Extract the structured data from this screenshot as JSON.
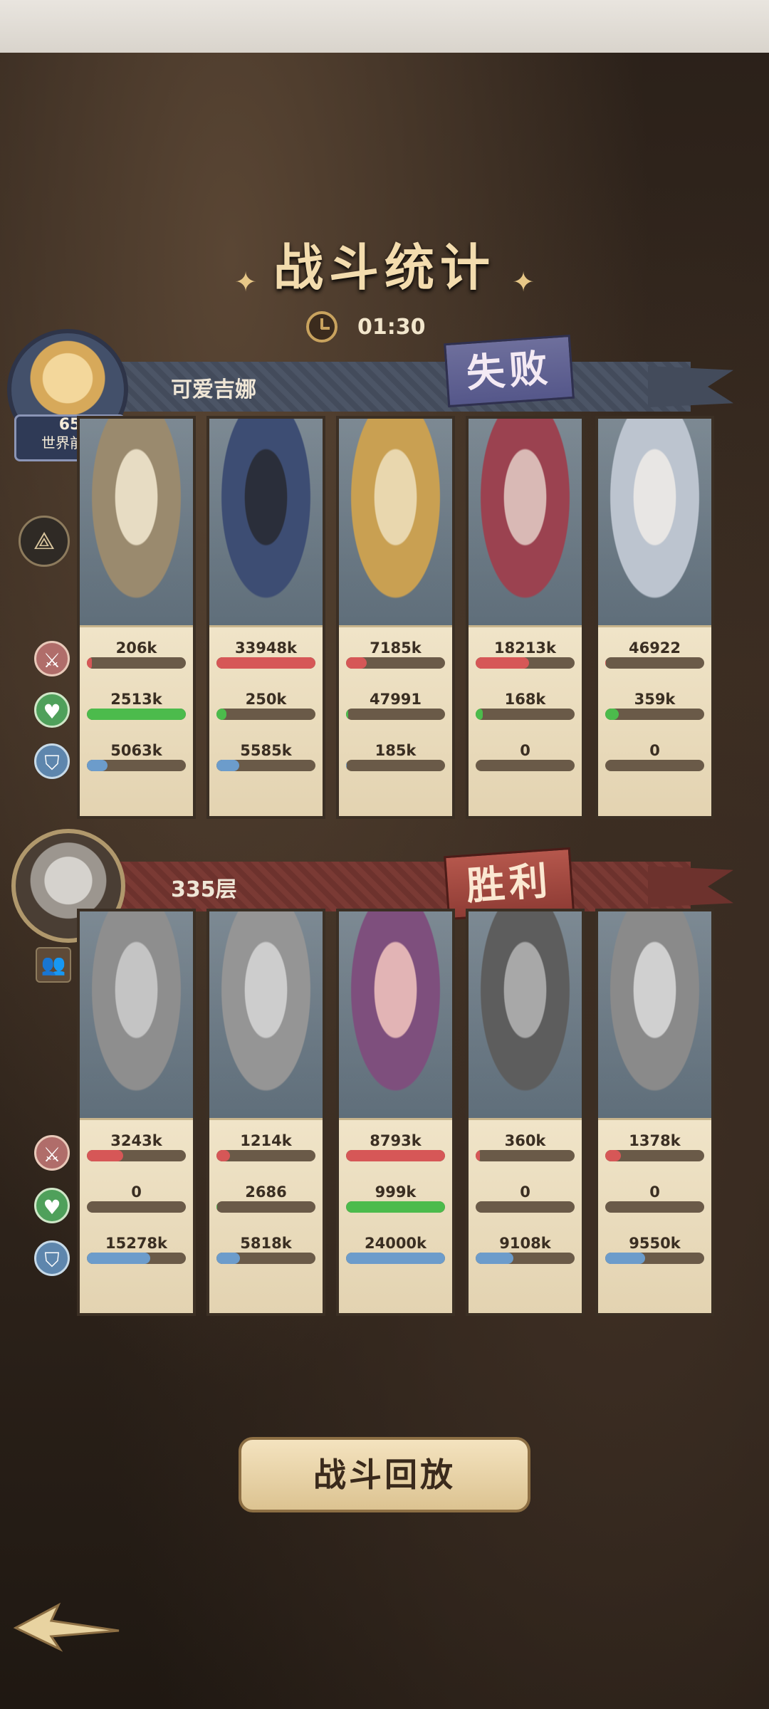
{
  "title": "战斗统计",
  "timer": "01:30",
  "team1": {
    "name": "可爱吉娜",
    "result": "失败",
    "level": "65",
    "rank_tag": "世界前十",
    "heroes": [
      {
        "atk": "206k",
        "atk_p": 0.05,
        "heal": "2513k",
        "heal_p": 1.0,
        "def": "5063k",
        "def_p": 0.21,
        "colors": [
          "#9a8a6e",
          "#e7dcc3"
        ]
      },
      {
        "atk": "33948k",
        "atk_p": 1.0,
        "heal": "250k",
        "heal_p": 0.1,
        "def": "5585k",
        "def_p": 0.23,
        "colors": [
          "#3d4d73",
          "#2a2e3a"
        ]
      },
      {
        "atk": "7185k",
        "atk_p": 0.21,
        "heal": "47991",
        "heal_p": 0.02,
        "def": "185k",
        "def_p": 0.01,
        "colors": [
          "#c9a052",
          "#e9d7ae"
        ]
      },
      {
        "atk": "18213k",
        "atk_p": 0.54,
        "heal": "168k",
        "heal_p": 0.07,
        "def": "0",
        "def_p": 0.0,
        "colors": [
          "#9b4250",
          "#d9b9b5"
        ]
      },
      {
        "atk": "46922",
        "atk_p": 0.01,
        "heal": "359k",
        "heal_p": 0.14,
        "def": "0",
        "def_p": 0.0,
        "colors": [
          "#bcc4cf",
          "#e8e6e4"
        ]
      }
    ]
  },
  "team2": {
    "name": "335层",
    "result": "胜利",
    "heroes": [
      {
        "atk": "3243k",
        "atk_p": 0.37,
        "heal": "0",
        "heal_p": 0.0,
        "def": "15278k",
        "def_p": 0.64,
        "colors": [
          "#8e8e8e",
          "#c4c4c4"
        ]
      },
      {
        "atk": "1214k",
        "atk_p": 0.14,
        "heal": "2686",
        "heal_p": 0.01,
        "def": "5818k",
        "def_p": 0.24,
        "colors": [
          "#959595",
          "#cdcdcd"
        ]
      },
      {
        "atk": "8793k",
        "atk_p": 1.0,
        "heal": "999k",
        "heal_p": 1.0,
        "def": "24000k",
        "def_p": 1.0,
        "colors": [
          "#7e4f7d",
          "#e2b4b5"
        ]
      },
      {
        "atk": "360k",
        "atk_p": 0.04,
        "heal": "0",
        "heal_p": 0.0,
        "def": "9108k",
        "def_p": 0.38,
        "colors": [
          "#5d5d5d",
          "#a8a8a8"
        ]
      },
      {
        "atk": "1378k",
        "atk_p": 0.16,
        "heal": "0",
        "heal_p": 0.0,
        "def": "9550k",
        "def_p": 0.4,
        "colors": [
          "#8a8a8a",
          "#d0d0d0"
        ]
      }
    ]
  },
  "replay_button": "战斗回放",
  "icons": {
    "atk": "sword-icon",
    "heal": "heart-plus-icon",
    "def": "shield-icon",
    "formation": "triangle-formation-icon",
    "team": "team-icon",
    "clock": "clock-icon",
    "back": "back-arrow-icon"
  }
}
